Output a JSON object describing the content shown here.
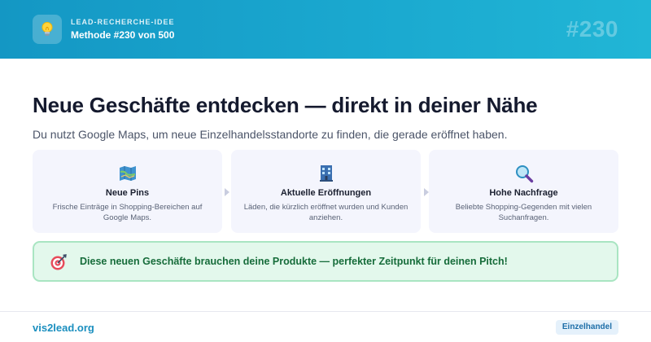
{
  "header": {
    "eyebrow": "LEAD-RECHERCHE-IDEE",
    "method": "Methode #230 von 500",
    "number": "#230",
    "logo_icon": "lightbulb-icon"
  },
  "main": {
    "headline": "Neue Geschäfte entdecken — direkt in deiner Nähe",
    "subline": "Du nutzt Google Maps, um neue Einzelhandelsstandorte zu finden, die gerade eröffnet haben."
  },
  "steps": [
    {
      "icon": "map-icon",
      "title": "Neue Pins",
      "desc": "Frische Einträge in Shopping-Bereichen auf Google Maps."
    },
    {
      "icon": "building-icon",
      "title": "Aktuelle Eröffnungen",
      "desc": "Läden, die kürzlich eröffnet wurden und Kunden anziehen."
    },
    {
      "icon": "magnifier-icon",
      "title": "Hohe Nachfrage",
      "desc": "Beliebte Shopping-Gegenden mit vielen Suchanfragen."
    }
  ],
  "callout": {
    "icon": "target-icon",
    "text": "Diese neuen Geschäfte brauchen deine Produkte — perfekter Zeitpunkt für deinen Pitch!"
  },
  "footer": {
    "site": "vis2lead.org",
    "tag": "Einzelhandel"
  },
  "colors": {
    "accent": "#1aa8cf",
    "success_bg": "#e3f8ec",
    "success_text": "#166c3a",
    "link": "#1b8fbf"
  }
}
